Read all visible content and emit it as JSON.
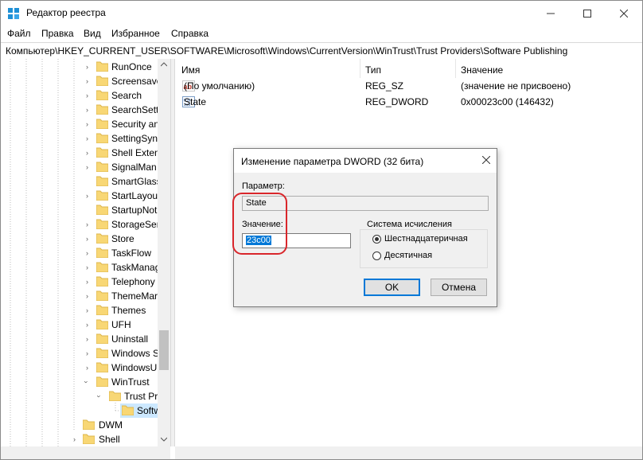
{
  "window": {
    "title": "Редактор реестра",
    "minimize_icon": "minimize-icon",
    "maximize_icon": "maximize-icon",
    "close_icon": "close-icon"
  },
  "menu": [
    "Файл",
    "Правка",
    "Вид",
    "Избранное",
    "Справка"
  ],
  "address": "Компьютер\\HKEY_CURRENT_USER\\SOFTWARE\\Microsoft\\Windows\\CurrentVersion\\WinTrust\\Trust Providers\\Software Publishing",
  "tree": {
    "items": [
      {
        "label": "RunOnce"
      },
      {
        "label": "Screensave"
      },
      {
        "label": "Search"
      },
      {
        "label": "SearchSetti"
      },
      {
        "label": "Security an"
      },
      {
        "label": "SettingSyn"
      },
      {
        "label": "Shell Exten"
      },
      {
        "label": "SignalMan"
      },
      {
        "label": "SmartGlass"
      },
      {
        "label": "StartLayou"
      },
      {
        "label": "StartupNot"
      },
      {
        "label": "StorageSer"
      },
      {
        "label": "Store"
      },
      {
        "label": "TaskFlow"
      },
      {
        "label": "TaskManag"
      },
      {
        "label": "Telephony"
      },
      {
        "label": "ThemeMar"
      },
      {
        "label": "Themes"
      },
      {
        "label": "UFH"
      },
      {
        "label": "Uninstall"
      },
      {
        "label": "Windows S"
      },
      {
        "label": "WindowsU"
      },
      {
        "label": "WinTrust"
      },
      {
        "label": "Trust Pro"
      },
      {
        "label": "Softw"
      },
      {
        "label": "DWM"
      },
      {
        "label": "Shell"
      }
    ]
  },
  "list": {
    "columns": [
      "Имя",
      "Тип",
      "Значение"
    ],
    "rows": [
      {
        "name": "(По умолчанию)",
        "type": "REG_SZ",
        "value": "(значение не присвоено)",
        "icon": "string-value-icon"
      },
      {
        "name": "State",
        "type": "REG_DWORD",
        "value": "0x00023c00 (146432)",
        "icon": "binary-value-icon"
      }
    ]
  },
  "dialog": {
    "title": "Изменение параметра DWORD (32 бита)",
    "param_label": "Параметр:",
    "param_value": "State",
    "value_label": "Значение:",
    "value": "23c00",
    "base_group": "Система исчисления",
    "radio_hex": "Шестнадцатеричная",
    "radio_dec": "Десятичная",
    "selected_base": "hex",
    "ok": "OK",
    "cancel": "Отмена"
  },
  "colors": {
    "annotation": "#d9262b",
    "selection": "#0078d7",
    "folder": "#f8d775"
  }
}
